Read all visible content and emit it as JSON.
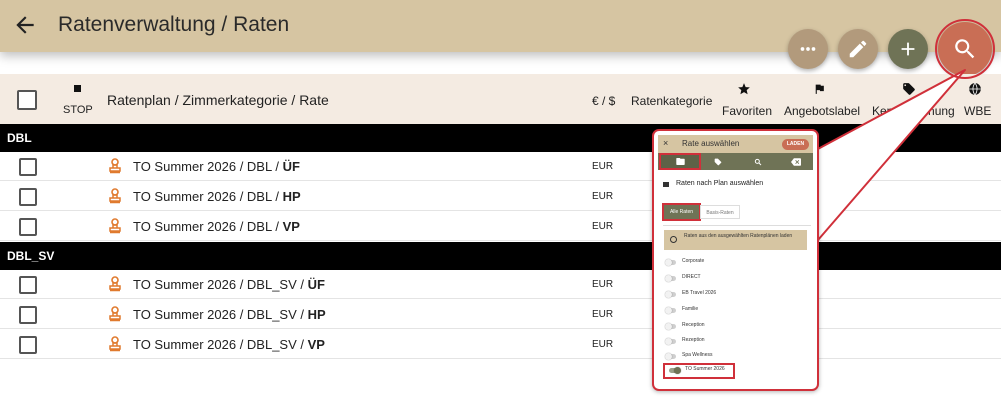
{
  "header": {
    "title": "Ratenverwaltung / Raten",
    "bg_color": "#d6c5a2"
  },
  "fabs": {
    "more": "more-horiz-icon",
    "edit": "pencil-icon",
    "add": "plus-icon",
    "search": "search-icon",
    "colors": {
      "secondary": "#b29a7c",
      "add": "#6f7356",
      "search": "#c96e55"
    }
  },
  "columns": {
    "stop": "STOP",
    "name": "Ratenplan / Zimmerkategorie / Rate",
    "currency": "€ / $",
    "category": "Ratenkategorie",
    "favorites": "Favoriten",
    "offer_label": "Angebotslabel",
    "tag_label": "Kennzeichnung",
    "wbe": "WBE"
  },
  "groups": [
    {
      "label": "DBL",
      "rows": [
        {
          "prefix": "TO Summer 2026 / DBL / ",
          "rate": "ÜF",
          "currency": "EUR"
        },
        {
          "prefix": "TO Summer 2026 / DBL / ",
          "rate": "HP",
          "currency": "EUR"
        },
        {
          "prefix": "TO Summer 2026 / DBL / ",
          "rate": "VP",
          "currency": "EUR"
        }
      ]
    },
    {
      "label": "DBL_SV",
      "rows": [
        {
          "prefix": "TO Summer 2026 / DBL_SV / ",
          "rate": "ÜF",
          "currency": "EUR"
        },
        {
          "prefix": "TO Summer 2026 / DBL_SV / ",
          "rate": "HP",
          "currency": "EUR"
        },
        {
          "prefix": "TO Summer 2026 / DBL_SV / ",
          "rate": "VP",
          "currency": "EUR"
        }
      ]
    }
  ],
  "zoom_panel": {
    "close": "×",
    "title": "Rate auswählen",
    "load_button": "LADEN",
    "subtitle": "Raten nach Plan auswählen",
    "btn_all": "Alle Raten",
    "btn_base": "Basis-Raten",
    "info": "Raten aus den ausgewählten Ratenplänen laden",
    "plans": [
      {
        "label": "Corporate",
        "on": false
      },
      {
        "label": "DIRECT",
        "on": false
      },
      {
        "label": "EB Travel 2026",
        "on": false
      },
      {
        "label": "Familie",
        "on": false
      },
      {
        "label": "Reception",
        "on": false
      },
      {
        "label": "Rezeption",
        "on": false
      },
      {
        "label": "Spa Wellness",
        "on": false
      },
      {
        "label": "TO Summer 2026",
        "on": true
      }
    ]
  },
  "accent_colors": {
    "highlight": "#d0303a",
    "rate_icon": "#e07a2e"
  }
}
